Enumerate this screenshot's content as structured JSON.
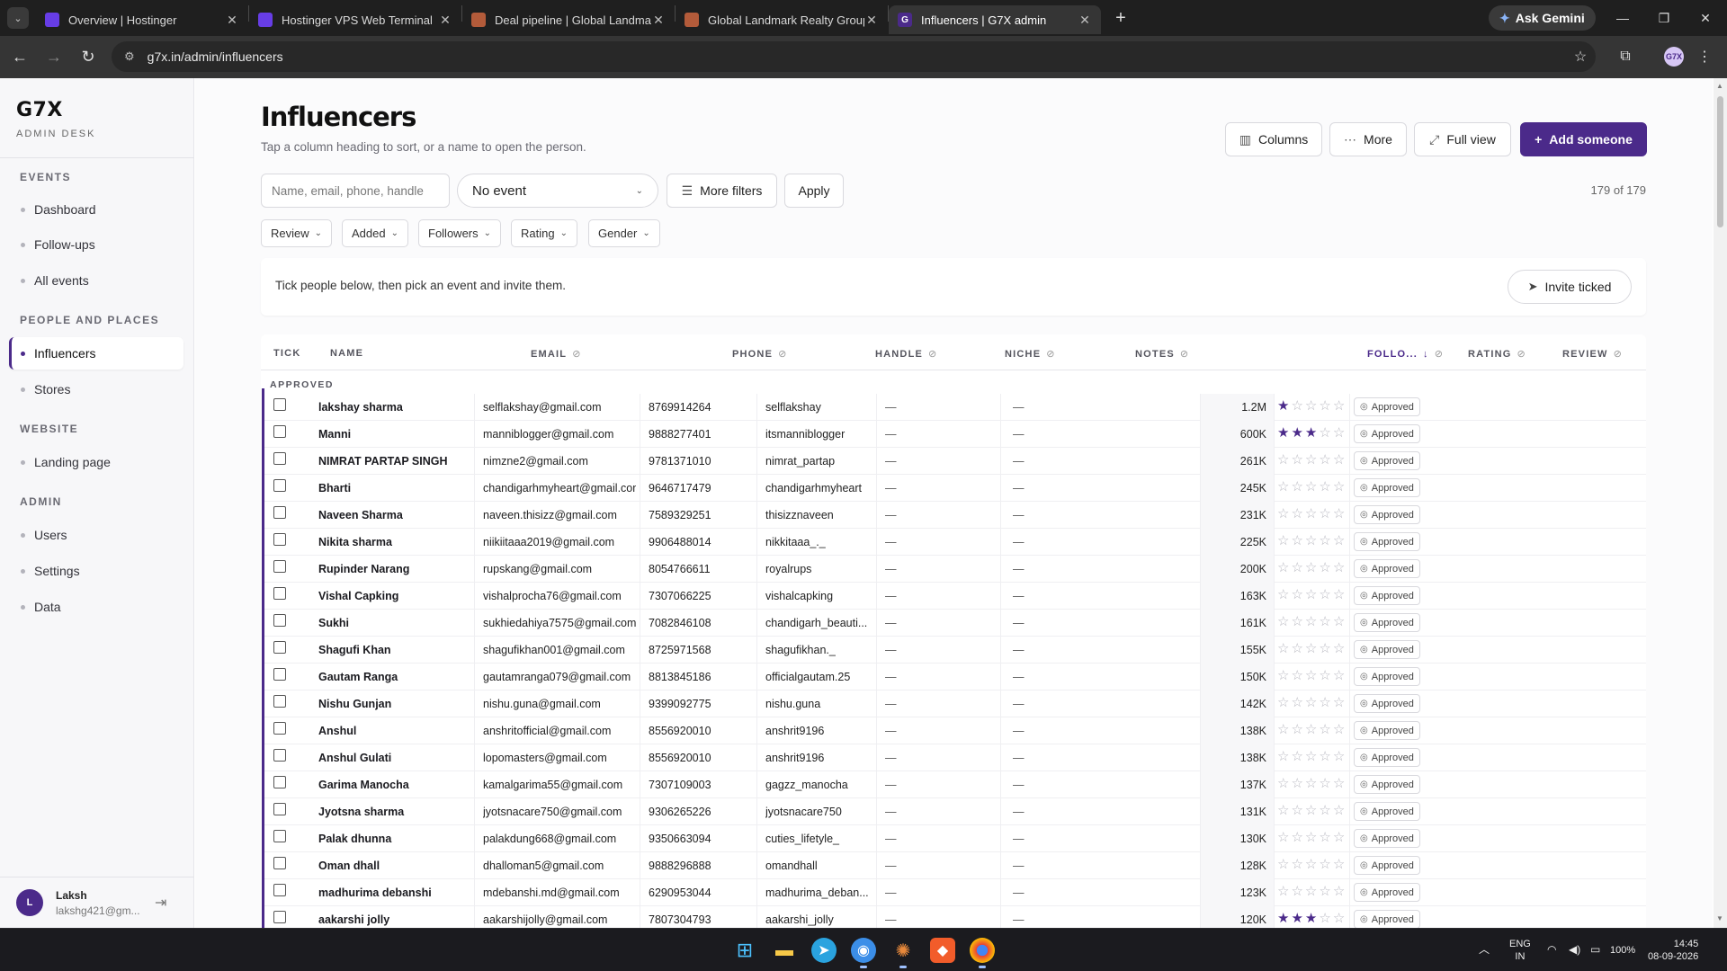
{
  "browser": {
    "tabs": [
      {
        "title": "Overview | Hostinger",
        "fav": "h"
      },
      {
        "title": "Hostinger VPS Web Terminal",
        "fav": "h"
      },
      {
        "title": "Deal pipeline | Global Landmark",
        "fav": "g"
      },
      {
        "title": "Global Landmark Realty Group",
        "fav": "g"
      },
      {
        "title": "Influencers | G7X admin",
        "fav": "x",
        "active": true
      }
    ],
    "gemini_label": "Ask Gemini",
    "url": "g7x.in/admin/influencers",
    "profile_label": "G7X"
  },
  "sidebar": {
    "brand": "G7X",
    "brand_sub": "ADMIN DESK",
    "sections": {
      "events": "EVENTS",
      "people": "PEOPLE AND PLACES",
      "website": "WEBSITE",
      "admin": "ADMIN"
    },
    "items": {
      "dashboard": "Dashboard",
      "followups": "Follow-ups",
      "all_events": "All events",
      "influencers": "Influencers",
      "stores": "Stores",
      "landing": "Landing page",
      "users": "Users",
      "settings": "Settings",
      "data": "Data"
    },
    "user": {
      "initial": "L",
      "name": "Laksh",
      "email": "lakshg421@gm..."
    }
  },
  "page": {
    "title": "Influencers",
    "subtitle": "Tap a column heading to sort, or a name to open the person.",
    "buttons": {
      "columns": "Columns",
      "more": "More",
      "full_view": "Full view",
      "add": "Add someone"
    },
    "search_placeholder": "Name, email, phone, handle",
    "event_select": "No event",
    "more_filters": "More filters",
    "apply": "Apply",
    "count": "179 of 179",
    "chips": [
      "Review",
      "Added",
      "Followers",
      "Rating",
      "Gender"
    ],
    "invite_msg": "Tick people below, then pick an event and invite them.",
    "invite_btn": "Invite ticked"
  },
  "table": {
    "headers": {
      "tick": "TICK",
      "name": "NAME",
      "email": "EMAIL",
      "phone": "PHONE",
      "handle": "HANDLE",
      "niche": "NICHE",
      "notes": "NOTES",
      "followers": "FOLLO...",
      "rating": "RATING",
      "review": "REVIEW"
    },
    "group_label": "APPROVED",
    "rows": [
      {
        "name": "lakshay sharma",
        "email": "selflakshay@gmail.com",
        "phone": "8769914264",
        "handle": "selflakshay",
        "niche": "—",
        "notes": "—",
        "followers": "1.2M",
        "rating": 1,
        "review": "Approved"
      },
      {
        "name": "Manni",
        "email": "manniblogger@gmail.com",
        "phone": "9888277401",
        "handle": "itsmanniblogger",
        "niche": "—",
        "notes": "—",
        "followers": "600K",
        "rating": 3,
        "review": "Approved"
      },
      {
        "name": "NIMRAT PARTAP SINGH",
        "email": "nimzne2@gmail.com",
        "phone": "9781371010",
        "handle": "nimrat_partap",
        "niche": "—",
        "notes": "—",
        "followers": "261K",
        "rating": 0,
        "review": "Approved"
      },
      {
        "name": "Bharti",
        "email": "chandigarhmyheart@gmail.com",
        "phone": "9646717479",
        "handle": "chandigarhmyheart",
        "niche": "—",
        "notes": "—",
        "followers": "245K",
        "rating": 0,
        "review": "Approved"
      },
      {
        "name": "Naveen Sharma",
        "email": "naveen.thisizz@gmail.com",
        "phone": "7589329251",
        "handle": "thisizznaveen",
        "niche": "—",
        "notes": "—",
        "followers": "231K",
        "rating": 0,
        "review": "Approved"
      },
      {
        "name": "Nikita sharma",
        "email": "niikiitaaa2019@gmail.com",
        "phone": "9906488014",
        "handle": "nikkitaaa_._",
        "niche": "—",
        "notes": "—",
        "followers": "225K",
        "rating": 0,
        "review": "Approved"
      },
      {
        "name": "Rupinder Narang",
        "email": "rupskang@gmail.com",
        "phone": "8054766611",
        "handle": "royalrups",
        "niche": "—",
        "notes": "—",
        "followers": "200K",
        "rating": 0,
        "review": "Approved"
      },
      {
        "name": "Vishal Capking",
        "email": "vishalprocha76@gmail.com",
        "phone": "7307066225",
        "handle": "vishalcapking",
        "niche": "—",
        "notes": "—",
        "followers": "163K",
        "rating": 0,
        "review": "Approved"
      },
      {
        "name": "Sukhi",
        "email": "sukhiedahiya7575@gmail.com",
        "phone": "7082846108",
        "handle": "chandigarh_beauti...",
        "niche": "—",
        "notes": "—",
        "followers": "161K",
        "rating": 0,
        "review": "Approved"
      },
      {
        "name": "Shagufi Khan",
        "email": "shagufikhan001@gmail.com",
        "phone": "8725971568",
        "handle": "shagufikhan._",
        "niche": "—",
        "notes": "—",
        "followers": "155K",
        "rating": 0,
        "review": "Approved"
      },
      {
        "name": "Gautam Ranga",
        "email": "gautamranga079@gmail.com",
        "phone": "8813845186",
        "handle": "officialgautam.25",
        "niche": "—",
        "notes": "—",
        "followers": "150K",
        "rating": 0,
        "review": "Approved"
      },
      {
        "name": "Nishu Gunjan",
        "email": "nishu.guna@gmail.com",
        "phone": "9399092775",
        "handle": "nishu.guna",
        "niche": "—",
        "notes": "—",
        "followers": "142K",
        "rating": 0,
        "review": "Approved"
      },
      {
        "name": "Anshul",
        "email": "anshritofficial@gmail.com",
        "phone": "8556920010",
        "handle": "anshrit9196",
        "niche": "—",
        "notes": "—",
        "followers": "138K",
        "rating": 0,
        "review": "Approved"
      },
      {
        "name": "Anshul Gulati",
        "email": "lopomasters@gmail.com",
        "phone": "8556920010",
        "handle": "anshrit9196",
        "niche": "—",
        "notes": "—",
        "followers": "138K",
        "rating": 0,
        "review": "Approved"
      },
      {
        "name": "Garima Manocha",
        "email": "kamalgarima55@gmail.com",
        "phone": "7307109003",
        "handle": "gagzz_manocha",
        "niche": "—",
        "notes": "—",
        "followers": "137K",
        "rating": 0,
        "review": "Approved"
      },
      {
        "name": "Jyotsna sharma",
        "email": "jyotsnacare750@gmail.com",
        "phone": "9306265226",
        "handle": "jyotsnacare750",
        "niche": "—",
        "notes": "—",
        "followers": "131K",
        "rating": 0,
        "review": "Approved"
      },
      {
        "name": "Palak dhunna",
        "email": "palakdung668@gmail.com",
        "phone": "9350663094",
        "handle": "cuties_lifetyle_",
        "niche": "—",
        "notes": "—",
        "followers": "130K",
        "rating": 0,
        "review": "Approved"
      },
      {
        "name": "Oman dhall",
        "email": "dhalloman5@gmail.com",
        "phone": "9888296888",
        "handle": "omandhall",
        "niche": "—",
        "notes": "—",
        "followers": "128K",
        "rating": 0,
        "review": "Approved"
      },
      {
        "name": "madhurima debanshi",
        "email": "mdebanshi.md@gmail.com",
        "phone": "6290953044",
        "handle": "madhurima_deban...",
        "niche": "—",
        "notes": "—",
        "followers": "123K",
        "rating": 0,
        "review": "Approved"
      },
      {
        "name": "aakarshi jolly",
        "email": "aakarshijolly@gmail.com",
        "phone": "7807304793",
        "handle": "aakarshi_jolly",
        "niche": "—",
        "notes": "—",
        "followers": "120K",
        "rating": 3,
        "review": "Approved"
      }
    ]
  },
  "taskbar": {
    "lang_1": "ENG",
    "lang_2": "IN",
    "battery": "100%",
    "time": "14:45",
    "date": "08-09-2026"
  },
  "colors": {
    "accent": "#4b2a8a",
    "sidebar_bg": "#f7f7f9",
    "chrome_dark": "#1f1f1f"
  }
}
